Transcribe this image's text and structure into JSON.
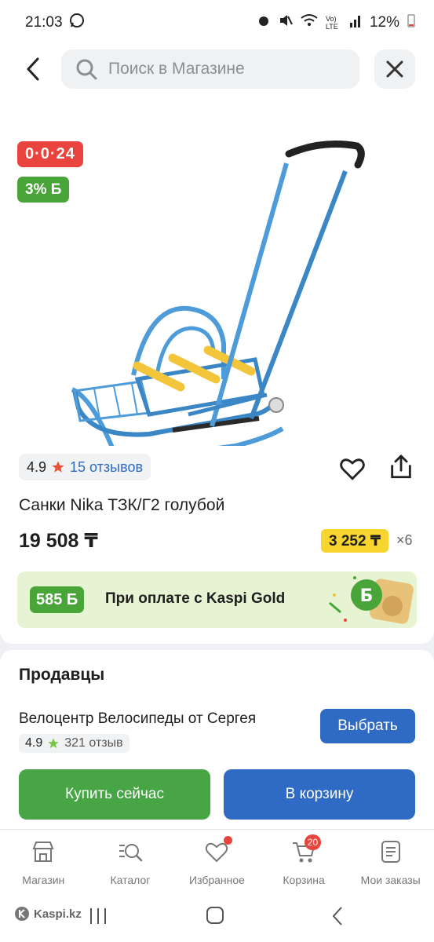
{
  "status_bar": {
    "time": "21:03",
    "battery": "12%",
    "network_label": "Vo) LTE"
  },
  "search": {
    "placeholder": "Поиск в Магазине"
  },
  "product": {
    "timer": "0·0·24",
    "bonus_badge": "3% Б",
    "rating": "4.9",
    "reviews": "15 отзывов",
    "title": "Санки Nika ТЗК/Г2 голубой",
    "price": "19 508 ₸",
    "installment_price": "3 252 ₸",
    "installment_multiplier": "×6"
  },
  "kaspi_gold": {
    "bonus": "585 Б",
    "text": "При оплате с Kaspi Gold"
  },
  "sellers": {
    "title": "Продавцы",
    "seller_name": "Велоцентр Велосипеды от Сергея",
    "seller_rating": "4.9",
    "seller_reviews": "321 отзыв",
    "choose_label": "Выбрать",
    "buy_now_label": "Купить сейчас",
    "add_to_cart_label": "В корзину"
  },
  "bottom_nav": {
    "items": [
      {
        "label": "Магазин",
        "icon": "store-icon"
      },
      {
        "label": "Каталог",
        "icon": "catalog-search-icon"
      },
      {
        "label": "Избранное",
        "icon": "heart-icon"
      },
      {
        "label": "Корзина",
        "icon": "cart-icon",
        "badge": "20"
      },
      {
        "label": "Мои заказы",
        "icon": "orders-icon"
      }
    ]
  },
  "watermark": "Kaspi.kz",
  "colors": {
    "red": "#e8433c",
    "green": "#49a53a",
    "blue": "#2f6bc4",
    "yellow": "#f8d52e",
    "gold_banner_bg": "#e7f4d4"
  }
}
